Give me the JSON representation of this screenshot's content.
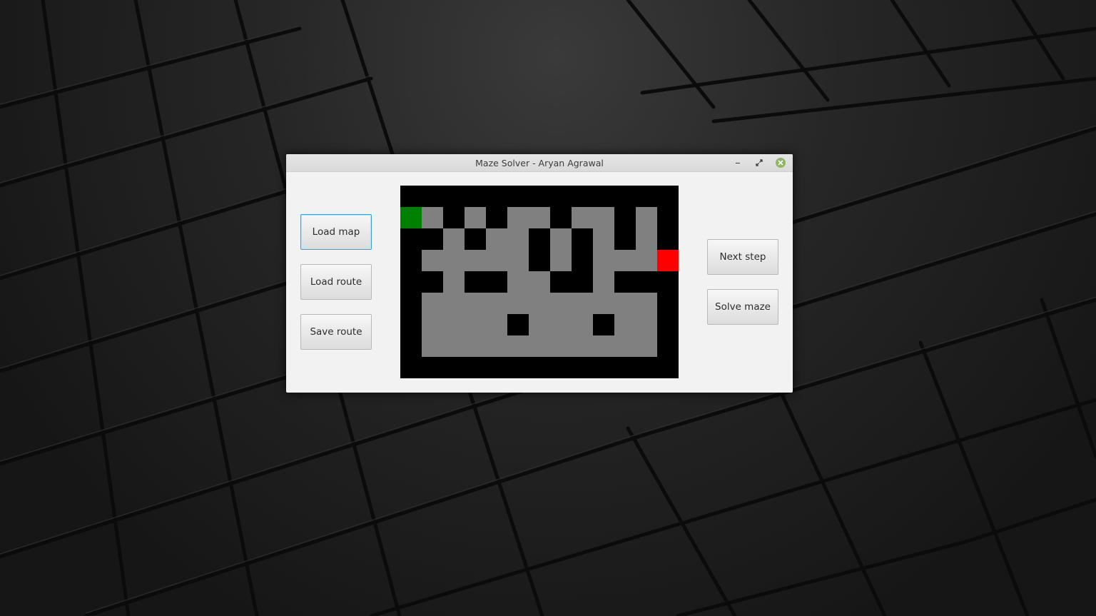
{
  "window": {
    "title": "Maze Solver - Aryan Agrawal",
    "controls": {
      "minimize_icon": "minimize-icon",
      "maximize_icon": "restore-icon",
      "close_icon": "close-icon"
    }
  },
  "left_buttons": [
    {
      "label": "Load map",
      "focused": true
    },
    {
      "label": "Load route",
      "focused": false
    },
    {
      "label": "Save route",
      "focused": false
    }
  ],
  "right_buttons": [
    {
      "label": "Next step"
    },
    {
      "label": "Solve maze"
    }
  ],
  "maze": {
    "rows": 9,
    "cols": 13,
    "legend": {
      "#": "wall",
      ".": "open",
      "S": "start",
      "E": "end"
    },
    "colors": {
      "wall": "#000000",
      "open": "#808080",
      "start": "#008000",
      "end": "#ff0000"
    },
    "grid": [
      "#############",
      "S.#.#..#..#.#",
      "##.#..#.#.#.#",
      "#.....#.#...E",
      "##.##..##.###",
      "#...........#",
      "#....#...#..#",
      "#...........#",
      "#############"
    ]
  }
}
